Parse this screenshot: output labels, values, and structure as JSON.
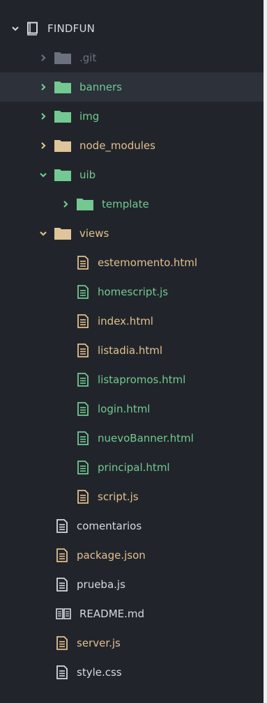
{
  "colors": {
    "panel_bg": "#21252b",
    "selected_bg": "#2c313a",
    "text_default": "#d7dae0",
    "text_dim": "#6b717d",
    "text_green": "#73c991",
    "text_orange": "#e2c08d",
    "folder_green": "#73c991",
    "folder_tan": "#e0c49a",
    "folder_gray": "#6b717d"
  },
  "tree": {
    "root": {
      "label": "FINDFUN",
      "icon": "book-icon",
      "expanded": true
    },
    "items": [
      {
        "id": "git",
        "label": ".git",
        "kind": "folder",
        "depth": 1,
        "expanded": false,
        "color": "dim",
        "selected": false
      },
      {
        "id": "banners",
        "label": "banners",
        "kind": "folder",
        "depth": 1,
        "expanded": false,
        "color": "green",
        "selected": true
      },
      {
        "id": "img",
        "label": "img",
        "kind": "folder",
        "depth": 1,
        "expanded": false,
        "color": "green",
        "selected": false
      },
      {
        "id": "node-modules",
        "label": "node_modules",
        "kind": "folder",
        "depth": 1,
        "expanded": false,
        "color": "orange",
        "selected": false
      },
      {
        "id": "uib",
        "label": "uib",
        "kind": "folder",
        "depth": 1,
        "expanded": true,
        "color": "green",
        "selected": false
      },
      {
        "id": "template",
        "label": "template",
        "kind": "folder",
        "depth": 2,
        "expanded": false,
        "color": "green",
        "selected": false
      },
      {
        "id": "views",
        "label": "views",
        "kind": "folder",
        "depth": 1,
        "expanded": true,
        "color": "orange",
        "selected": false
      },
      {
        "id": "estemomento",
        "label": "estemomento.html",
        "kind": "file",
        "depth": 2,
        "color": "orange"
      },
      {
        "id": "homescript",
        "label": "homescript.js",
        "kind": "file",
        "depth": 2,
        "color": "green"
      },
      {
        "id": "index",
        "label": "index.html",
        "kind": "file",
        "depth": 2,
        "color": "orange"
      },
      {
        "id": "listadia",
        "label": "listadia.html",
        "kind": "file",
        "depth": 2,
        "color": "orange"
      },
      {
        "id": "listapromos",
        "label": "listapromos.html",
        "kind": "file",
        "depth": 2,
        "color": "green"
      },
      {
        "id": "login",
        "label": "login.html",
        "kind": "file",
        "depth": 2,
        "color": "green"
      },
      {
        "id": "nuevobanner",
        "label": "nuevoBanner.html",
        "kind": "file",
        "depth": 2,
        "color": "green"
      },
      {
        "id": "principal",
        "label": "principal.html",
        "kind": "file",
        "depth": 2,
        "color": "green"
      },
      {
        "id": "script",
        "label": "script.js",
        "kind": "file",
        "depth": 2,
        "color": "orange"
      },
      {
        "id": "comentarios",
        "label": "comentarios",
        "kind": "file",
        "depth": 1,
        "color": "default"
      },
      {
        "id": "package-json",
        "label": "package.json",
        "kind": "file",
        "depth": 1,
        "color": "orange"
      },
      {
        "id": "prueba",
        "label": "prueba.js",
        "kind": "file",
        "depth": 1,
        "color": "default"
      },
      {
        "id": "readme",
        "label": "README.md",
        "kind": "readme",
        "depth": 1,
        "color": "default"
      },
      {
        "id": "server",
        "label": "server.js",
        "kind": "file",
        "depth": 1,
        "color": "orange"
      },
      {
        "id": "style",
        "label": "style.css",
        "kind": "file",
        "depth": 1,
        "color": "default"
      }
    ]
  }
}
